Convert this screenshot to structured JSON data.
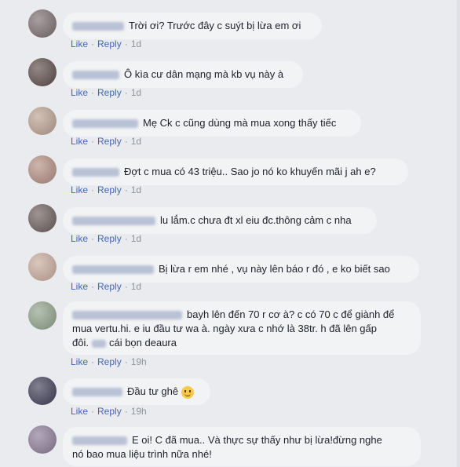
{
  "actions": {
    "like": "Like",
    "reply": "Reply",
    "dot": "·"
  },
  "comments": [
    {
      "text": "Trời ơi? Trước đây c suýt bị lừa em ơi",
      "time": "1d"
    },
    {
      "text": "Ô kìa cư dân mạng mà kb vụ này à",
      "time": "1d"
    },
    {
      "text": "Mẹ Ck c cũng dùng mà mua xong thấy tiếc",
      "time": "1d"
    },
    {
      "text": "Đợt c mua có 43 triệu.. Sao jo nó ko khuyến mãi j ah e?",
      "time": "1d"
    },
    {
      "text": "lu lắm.c chưa đt xl eiu đc.thông cảm c nha",
      "time": "1d"
    },
    {
      "text": "Bị lừa r em nhé , vụ này lên báo r đó , e ko biết sao",
      "time": "1d"
    },
    {
      "text_line1": "bayh lên đến 70 r cơ à? c có 70 c để giành để",
      "text_line2": "mua vertu.hi. e iu đầu tư wa à. ngày xưa c nhớ là 38tr. h đã lên gấp",
      "text_line3_prefix": "đôi.",
      "text_line3_suffix": "cái bọn deaura",
      "time": "19h"
    },
    {
      "text": "Đầu tư ghê",
      "emoji": "smile-emoji",
      "time": "19h"
    },
    {
      "text_line1": "E oi! C đã mua.. Và thực sự thấy như bị lừa!đừng nghe",
      "text_line2": "nó bao mua liệu trình nữa nhé!",
      "time": ""
    }
  ],
  "colors": {
    "link": "#4267b2",
    "meta": "#90949c",
    "bubble": "#f2f3f5",
    "background": "#e9ebee"
  }
}
